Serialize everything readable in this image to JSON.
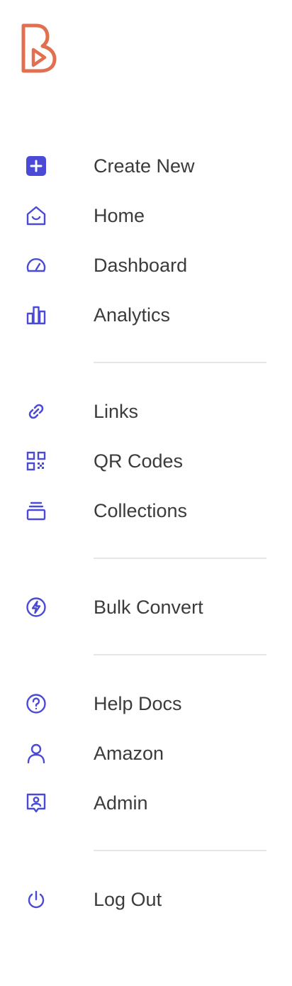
{
  "brand": {
    "logo_icon": "brand-b-play-logo",
    "logo_color": "#e07050"
  },
  "colors": {
    "icon": "#4a4ad6",
    "text": "#3b3b3b",
    "divider": "#e6e6e6"
  },
  "nav": {
    "create_new": {
      "label": "Create New",
      "icon": "plus-square-icon"
    },
    "home": {
      "label": "Home",
      "icon": "home-icon"
    },
    "dashboard": {
      "label": "Dashboard",
      "icon": "gauge-icon"
    },
    "analytics": {
      "label": "Analytics",
      "icon": "bar-chart-icon"
    },
    "links": {
      "label": "Links",
      "icon": "link-icon"
    },
    "qr_codes": {
      "label": "QR Codes",
      "icon": "qr-code-icon"
    },
    "collections": {
      "label": "Collections",
      "icon": "stack-icon"
    },
    "bulk_convert": {
      "label": "Bulk Convert",
      "icon": "lightning-circle-icon"
    },
    "help_docs": {
      "label": "Help Docs",
      "icon": "question-circle-icon"
    },
    "amazon": {
      "label": "Amazon",
      "icon": "user-icon"
    },
    "admin": {
      "label": "Admin",
      "icon": "user-badge-icon"
    },
    "log_out": {
      "label": "Log Out",
      "icon": "power-icon"
    }
  }
}
